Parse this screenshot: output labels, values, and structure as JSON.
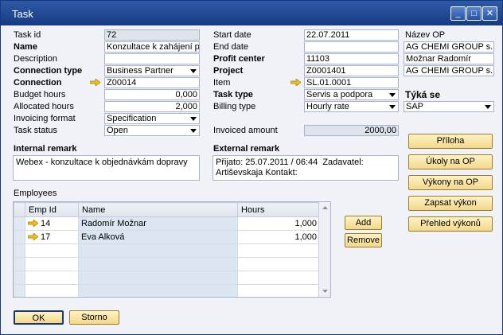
{
  "window": {
    "title": "Task",
    "min": "_",
    "max": "□",
    "close": "✕"
  },
  "left": {
    "task_id": {
      "label": "Task id",
      "value": "72"
    },
    "name": {
      "label": "Name",
      "value": "Konzultace k zahájení po"
    },
    "description": {
      "label": "Description",
      "value": ""
    },
    "connection_type": {
      "label": "Connection type",
      "value": "Business Partner"
    },
    "connection": {
      "label": "Connection",
      "value": "Z00014"
    },
    "budget_hours": {
      "label": "Budget hours",
      "value": "0,000"
    },
    "allocated_hours": {
      "label": "Allocated hours",
      "value": "2,000"
    },
    "invoicing_format": {
      "label": "Invoicing format",
      "value": "Specification"
    },
    "task_status": {
      "label": "Task status",
      "value": "Open"
    }
  },
  "middle": {
    "start_date": {
      "label": "Start date",
      "value": "22.07.2011"
    },
    "end_date": {
      "label": "End date",
      "value": ""
    },
    "profit_center": {
      "label": "Profit center",
      "value": "11103"
    },
    "project": {
      "label": "Project",
      "value": "Z0001401"
    },
    "item": {
      "label": "Item",
      "value": "SL.01.0001"
    },
    "task_type": {
      "label": "Task type",
      "value": "Servis a podpora"
    },
    "billing_type": {
      "label": "Billing type",
      "value": "Hourly rate"
    },
    "invoiced_amount": {
      "label": "Invoiced amount",
      "value": "2000,00"
    }
  },
  "right": {
    "nazev_op_label": "Název OP",
    "company1": "AG CHEMI GROUP s.r.o",
    "person": "Možnar Radomír",
    "company2": "AG CHEMI GROUP s.r.o",
    "tyka_se_label": "Týká se",
    "tyka_se_value": "SAP"
  },
  "remarks": {
    "internal_label": "Internal remark",
    "internal_value": "Webex - konzultace k objednávkám dopravy",
    "external_label": "External remark",
    "external_value": "Přijato: 25.07.2011 / 06:44  Zadavatel:\nArtiševskaja Kontakt:"
  },
  "side_buttons": [
    "Příloha",
    "Úkoly na OP",
    "Výkony na OP",
    "Zapsat výkon",
    "Přehled výkonů"
  ],
  "employees": {
    "label": "Employees",
    "columns": [
      "Emp Id",
      "Name",
      "Hours"
    ],
    "rows": [
      {
        "emp_id": "14",
        "name": "Radomír Možnar",
        "hours": "1,000"
      },
      {
        "emp_id": "17",
        "name": "Eva Alková",
        "hours": "1,000"
      }
    ],
    "add_label": "Add",
    "remove_label": "Remove"
  },
  "footer": {
    "ok_label": "OK",
    "cancel_label": "Storno"
  },
  "colors": {
    "accent": "#163a82",
    "button": "#f3d88a",
    "link_arrow": "#f2c018"
  }
}
